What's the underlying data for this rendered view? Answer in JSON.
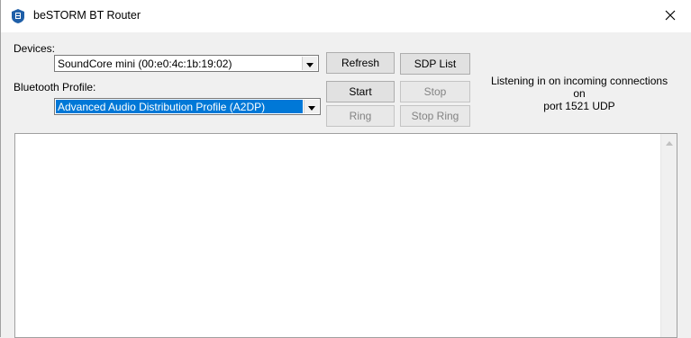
{
  "window": {
    "title": "beSTORM BT Router"
  },
  "devices": {
    "label": "Devices:",
    "selected": "SoundCore mini (00:e0:4c:1b:19:02)"
  },
  "profile": {
    "label": "Bluetooth Profile:",
    "selected": "Advanced Audio Distribution Profile (A2DP)"
  },
  "buttons": {
    "refresh": "Refresh",
    "sdp_list": "SDP List",
    "start": "Start",
    "stop": "Stop",
    "ring": "Ring",
    "stop_ring": "Stop Ring"
  },
  "status": {
    "line1": "Listening in on incoming connections on",
    "line2": "port 1521 UDP"
  },
  "colors": {
    "selection": "#0078d7",
    "window_bg": "#f0f0f0",
    "disabled_text": "#838383"
  },
  "icons": {
    "app": "bestorm-app-icon",
    "close": "close-icon",
    "dropdown": "chevron-down-icon",
    "scroll_up": "scroll-up-icon"
  }
}
